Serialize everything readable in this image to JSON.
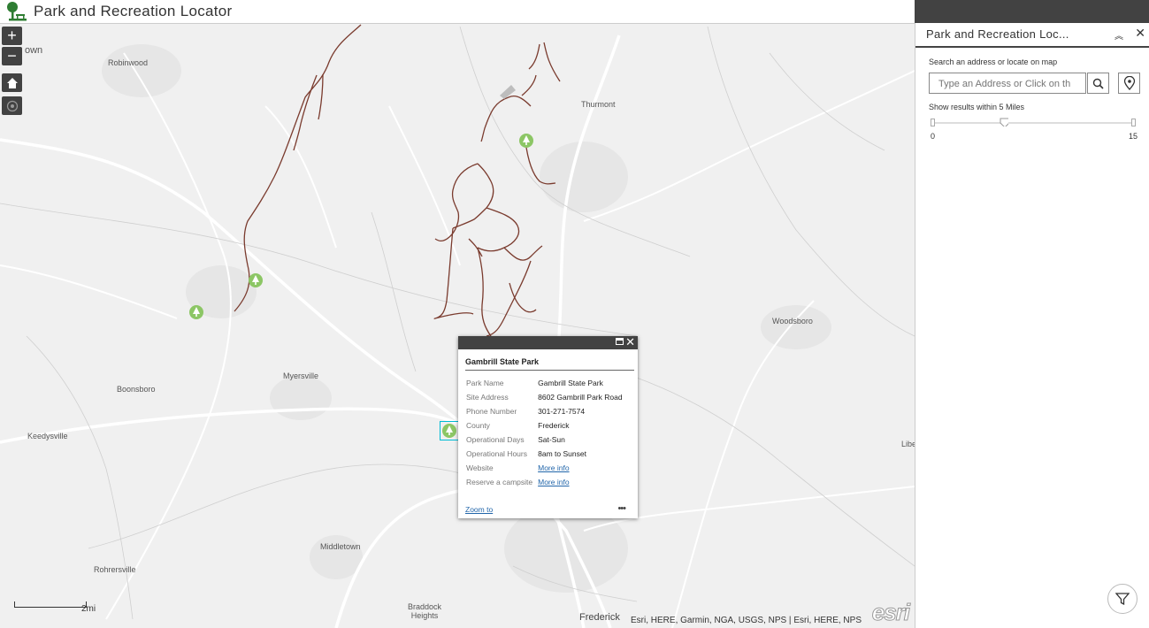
{
  "app": {
    "title": "Park and Recreation Locator"
  },
  "map": {
    "place_labels": {
      "robinwood": "Robinwood",
      "thurmont": "Thurmont",
      "woodsboro": "Woodsboro",
      "myersville": "Myersville",
      "boonsboro": "Boonsboro",
      "keedysville": "Keedysville",
      "middletown": "Middletown",
      "rohrersville": "Rohrersville",
      "braddock_heights": "Braddock Heights",
      "frederick": "Frederick",
      "own_partial": "own",
      "libe_partial": "Libe"
    },
    "zoom_in": "+",
    "zoom_out": "−",
    "scale_label": "2mi",
    "attribution": "Esri, HERE, Garmin, NGA, USGS, NPS | Esri, HERE, NPS",
    "esri_logo": "esri",
    "colors": {
      "trail": "#7a3b2e",
      "park_marker": "#8cc665",
      "selection": "#00bcd4"
    }
  },
  "popup": {
    "title": "Gambrill State Park",
    "fields": [
      {
        "label": "Park Name",
        "value": "Gambrill State Park"
      },
      {
        "label": "Site Address",
        "value": "8602 Gambrill Park Road"
      },
      {
        "label": "Phone Number",
        "value": "301-271-7574"
      },
      {
        "label": "County",
        "value": "Frederick"
      },
      {
        "label": "Operational Days",
        "value": "Sat-Sun"
      },
      {
        "label": "Operational Hours",
        "value": "8am to Sunset"
      },
      {
        "label": "Website",
        "value": "More info"
      },
      {
        "label": "Reserve a campsite",
        "value": "More info"
      }
    ],
    "zoom_to": "Zoom to",
    "more": "•••"
  },
  "panel": {
    "title": "Park and Recreation Loc...",
    "search_label": "Search an address or locate on map",
    "search_placeholder": "Type an Address or Click on th",
    "radius_label": "Show results within 5 Miles",
    "slider": {
      "min": "0",
      "max": "15",
      "value": 5
    }
  }
}
